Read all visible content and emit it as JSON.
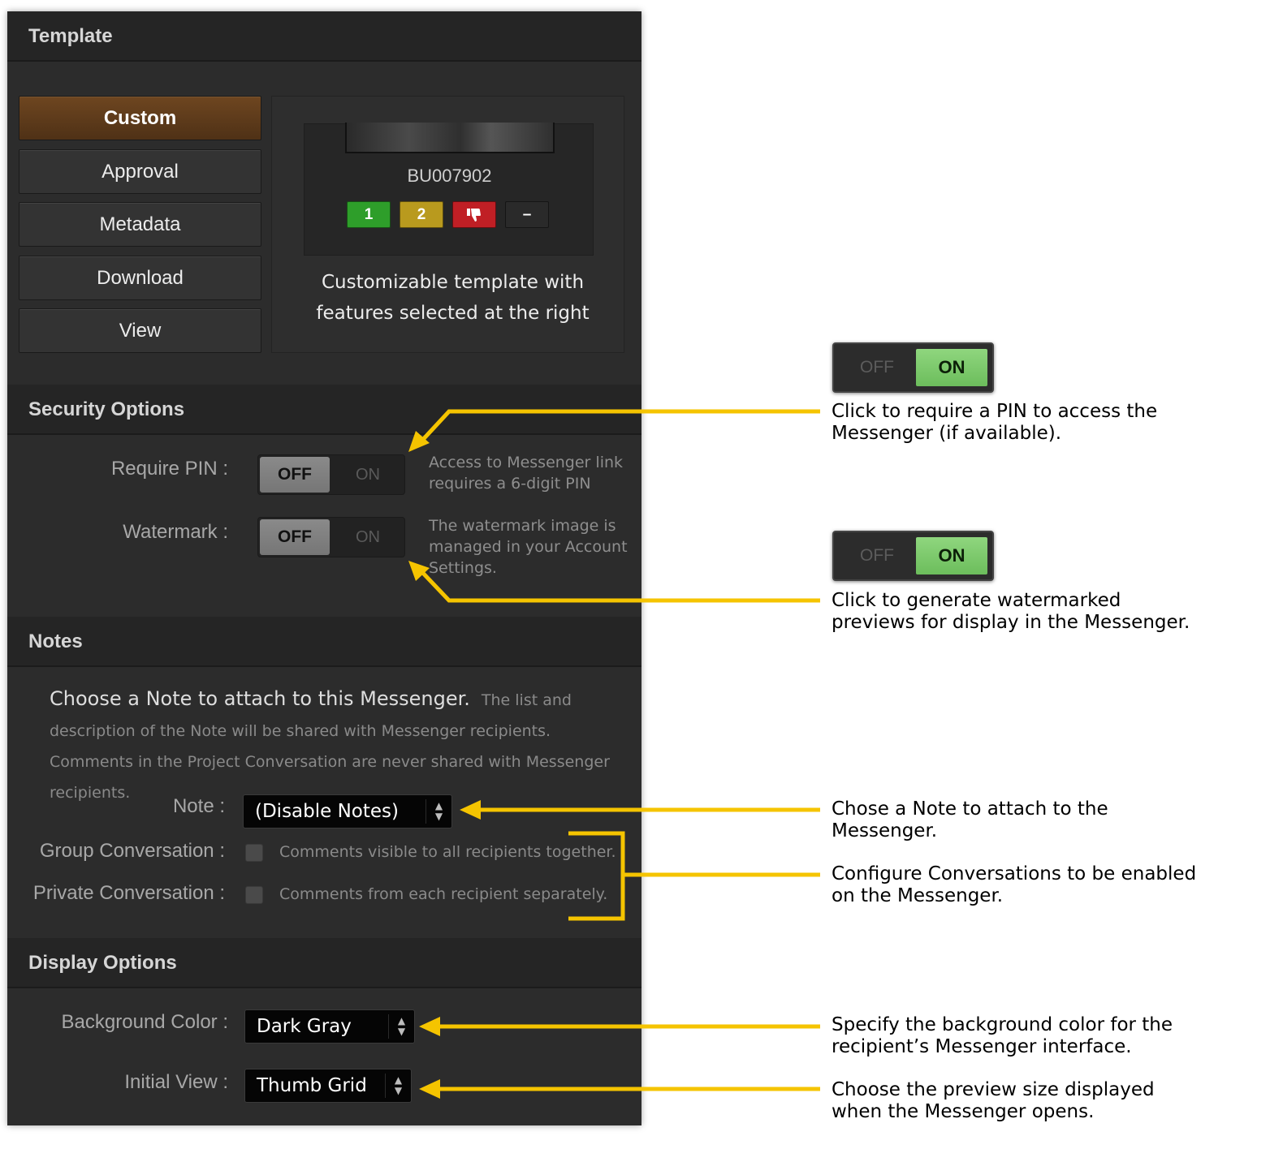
{
  "sections": {
    "template": "Template",
    "security": "Security Options",
    "notes": "Notes",
    "display": "Display Options"
  },
  "template_buttons": [
    {
      "label": "Custom",
      "active": true
    },
    {
      "label": "Approval",
      "active": false
    },
    {
      "label": "Metadata",
      "active": false
    },
    {
      "label": "Download",
      "active": false
    },
    {
      "label": "View",
      "active": false
    }
  ],
  "preview": {
    "asset_id": "BU007902",
    "marks": [
      {
        "label": "1",
        "color": "#2e9e2a",
        "icon": ""
      },
      {
        "label": "2",
        "color": "#b99a1e",
        "icon": ""
      },
      {
        "label": "",
        "color": "#c01f25",
        "icon": "thumbs-down-icon"
      },
      {
        "label": "–",
        "color": "#2a2a2a",
        "icon": ""
      }
    ],
    "caption_line1": "Customizable template with",
    "caption_line2": "features selected at the right"
  },
  "security": {
    "require_pin": {
      "label": "Require PIN :",
      "off": "OFF",
      "on": "ON",
      "state": "OFF",
      "hint_line1": "Access to Messenger link",
      "hint_line2": "requires a 6-digit PIN"
    },
    "watermark": {
      "label": "Watermark :",
      "off": "OFF",
      "on": "ON",
      "state": "OFF",
      "hint_line1": "The watermark image is",
      "hint_line2": "managed in your Account",
      "hint_line3": "Settings."
    }
  },
  "notes": {
    "intro_lead": "Choose a Note to attach to this Messenger.",
    "intro_rest": "The list and description of the Note will be shared with Messenger recipients. Comments in the Project Conversation are never shared with Messenger recipients.",
    "note_label": "Note :",
    "note_value": "(Disable Notes)",
    "group_label": "Group Conversation :",
    "group_text": "Comments visible to all recipients together.",
    "private_label": "Private Conversation :",
    "private_text": "Comments from each recipient separately."
  },
  "display": {
    "background_label": "Background Color :",
    "background_value": "Dark Gray",
    "initial_view_label": "Initial View :",
    "initial_view_value": "Thumb Grid"
  },
  "annotations": {
    "toggle_off": "OFF",
    "toggle_on": "ON",
    "pin_line1": "Click to require a PIN to access the",
    "pin_line2": "Messenger (if available).",
    "watermark_line1": "Click to generate watermarked",
    "watermark_line2": "previews for display in the Messenger.",
    "note_line1": "Chose a Note to attach to the",
    "note_line2": "Messenger.",
    "conv_line1": "Configure Conversations to be enabled",
    "conv_line2": "on the Messenger.",
    "bg_line1": "Specify the background color for the",
    "bg_line2": "recipient’s Messenger interface.",
    "view_line1": "Choose the preview size displayed",
    "view_line2": "when the Messenger opens."
  },
  "colors": {
    "accent_arrow": "#f5c400",
    "active_template": "#5e3b1b",
    "on_green": "#7ccb6a"
  }
}
